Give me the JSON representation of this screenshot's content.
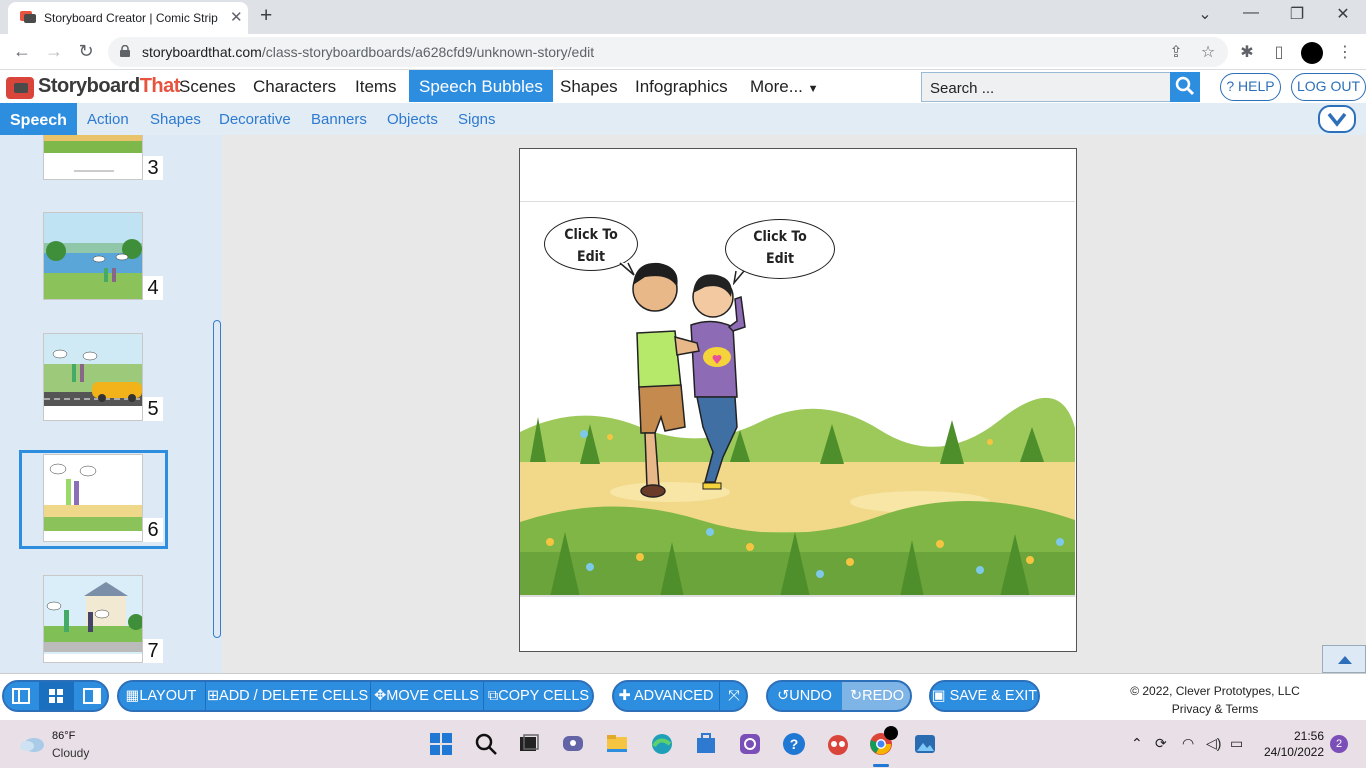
{
  "browser": {
    "tab_title": "Storyboard Creator | Comic Strip",
    "new_tab_symbol": "+",
    "url_host": "storyboardthat.com",
    "url_path": "/class-storyboardboards/a628cfd9/unknown-story/edit",
    "window_controls": [
      "⌄",
      "—",
      "❐",
      "✕"
    ]
  },
  "site": {
    "logo_text_1": "Storyboard",
    "logo_text_2": "That",
    "nav": [
      "Scenes",
      "Characters",
      "Items",
      "Speech Bubbles",
      "Shapes",
      "Infographics",
      "More..."
    ],
    "active_nav": "Speech Bubbles",
    "search_placeholder": "Search ...",
    "help_label": "? HELP",
    "logout_label": "LOG OUT"
  },
  "subnav": {
    "items": [
      "Speech",
      "Action",
      "Shapes",
      "Decorative",
      "Banners",
      "Objects",
      "Signs"
    ],
    "active": "Speech"
  },
  "thumbnails": [
    {
      "number": "3"
    },
    {
      "number": "4"
    },
    {
      "number": "5"
    },
    {
      "number": "6",
      "selected": true
    },
    {
      "number": "7"
    }
  ],
  "cell": {
    "bubble_left": [
      "Click To",
      "Edit"
    ],
    "bubble_right": [
      "Click To",
      "Edit"
    ]
  },
  "toolbar": {
    "layout": "LAYOUT",
    "add_delete": "ADD / DELETE CELLS",
    "move": "MOVE CELLS",
    "copy": "COPY CELLS",
    "advanced": "ADVANCED",
    "undo": "UNDO",
    "redo": "REDO",
    "save_exit": "SAVE & EXIT",
    "copyright": "© 2022, Clever Prototypes, LLC",
    "privacy": "Privacy & Terms"
  },
  "taskbar": {
    "weather_temp": "86°F",
    "weather_desc": "Cloudy",
    "time": "21:56",
    "date": "24/10/2022",
    "notification_count": "2"
  },
  "colors": {
    "accent": "#2d8ee0",
    "accent_dark": "#2d6fb8",
    "panel_bg": "#dde9f5",
    "logo_red": "#e8533f"
  }
}
